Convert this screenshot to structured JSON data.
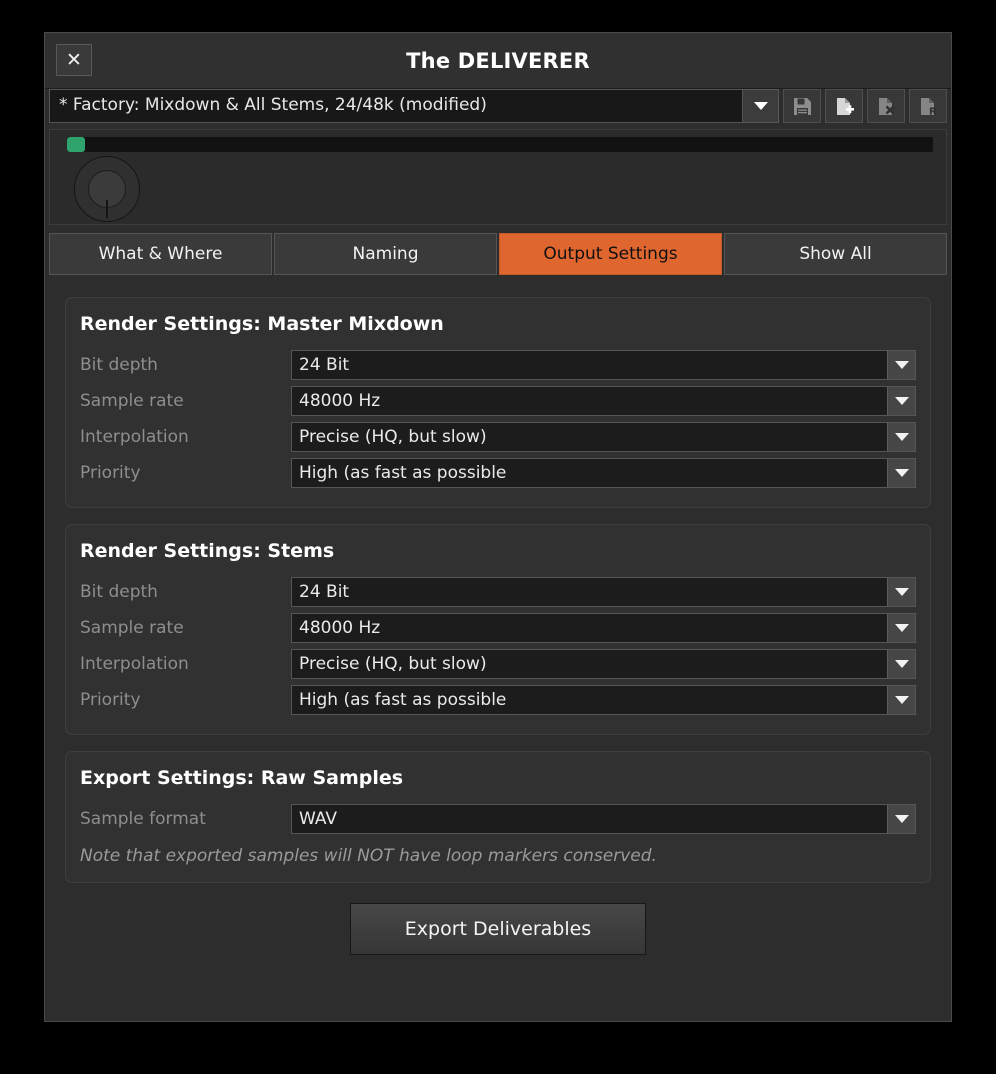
{
  "window": {
    "title": "The DELIVERER",
    "close_label": "✕"
  },
  "preset": {
    "value": "* Factory: Mixdown & All Stems, 24/48k (modified)",
    "placeholder": "Select preset",
    "dropdown_icon": "chevron-down-icon",
    "buttons": [
      {
        "name": "save-preset-button",
        "icon": "floppy-disk-icon"
      },
      {
        "name": "new-preset-button",
        "icon": "document-plus-icon"
      },
      {
        "name": "delete-preset-button",
        "icon": "document-x-icon"
      },
      {
        "name": "rename-preset-button",
        "icon": "document-r-icon"
      }
    ]
  },
  "meter": {
    "fill_color": "#2fa36c",
    "track_color": "#121212",
    "knob_name": "output-level-knob"
  },
  "tabs": [
    {
      "label": "What & Where",
      "active": false
    },
    {
      "label": "Naming",
      "active": false
    },
    {
      "label": "Output Settings",
      "active": true
    },
    {
      "label": "Show All",
      "active": false
    }
  ],
  "panels": [
    {
      "title": "Render Settings: Master Mixdown",
      "rows": [
        {
          "label": "Bit depth",
          "value": "24 Bit"
        },
        {
          "label": "Sample rate",
          "value": "48000 Hz"
        },
        {
          "label": "Interpolation",
          "value": "Precise (HQ, but slow)"
        },
        {
          "label": "Priority",
          "value": "High (as fast as possible"
        }
      ]
    },
    {
      "title": "Render Settings: Stems",
      "rows": [
        {
          "label": "Bit depth",
          "value": "24 Bit"
        },
        {
          "label": "Sample rate",
          "value": "48000 Hz"
        },
        {
          "label": "Interpolation",
          "value": "Precise (HQ, but slow)"
        },
        {
          "label": "Priority",
          "value": "High (as fast as possible"
        }
      ]
    },
    {
      "title": "Export Settings: Raw Samples",
      "rows": [
        {
          "label": "Sample format",
          "value": "WAV"
        }
      ],
      "note": "Note that exported samples will NOT have loop markers conserved."
    }
  ],
  "export_button": {
    "label": "Export Deliverables"
  },
  "colors": {
    "accent": "#df672f",
    "status_green": "#2fa36c",
    "window_bg": "#2d2d2d",
    "panel_bg": "#313131"
  }
}
